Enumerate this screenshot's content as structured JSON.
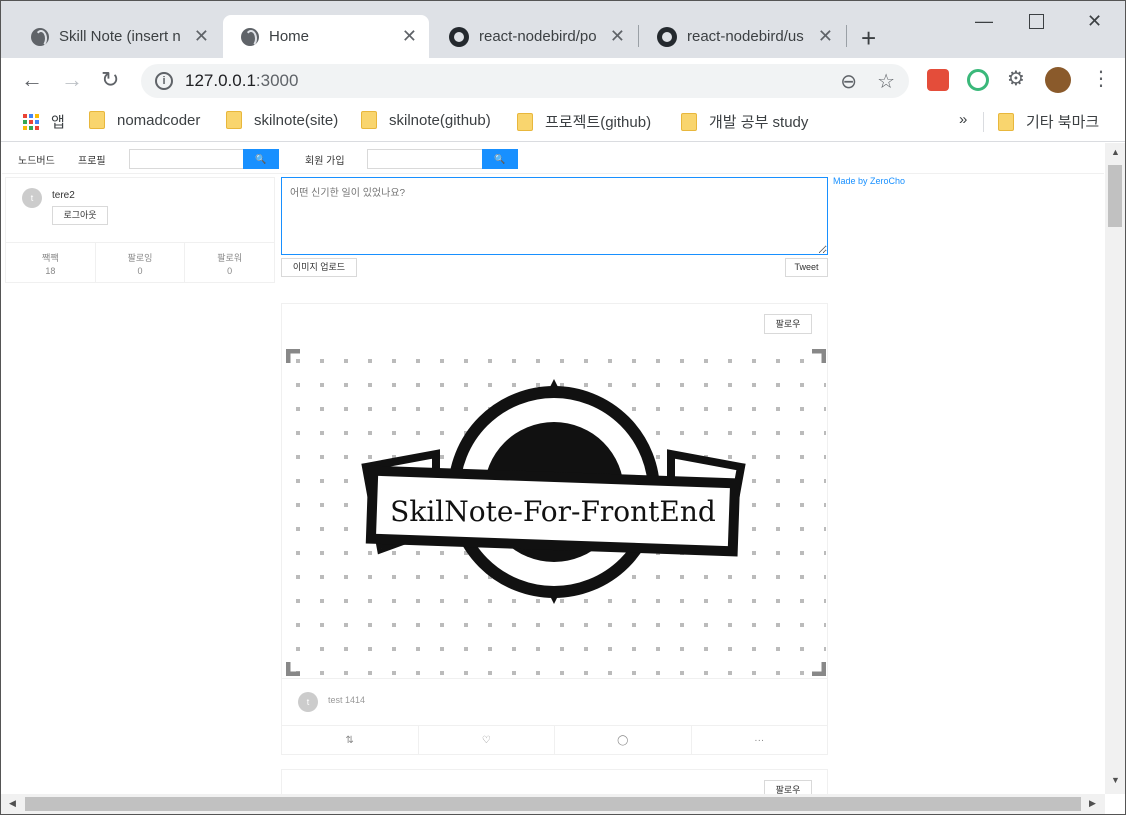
{
  "browser": {
    "tabs": [
      {
        "title": "Skill Note (insert n",
        "icon": "globe-icon",
        "active": false
      },
      {
        "title": "Home",
        "icon": "globe-icon",
        "active": true
      },
      {
        "title": "react-nodebird/po",
        "icon": "github-icon",
        "active": false
      },
      {
        "title": "react-nodebird/us",
        "icon": "github-icon",
        "active": false
      }
    ],
    "new_tab": "+",
    "close_glyph": "✕",
    "url_host": "127.0.0.1",
    "url_port": ":3000",
    "bookmarks": {
      "apps_label": "앱",
      "items": [
        "nomadcoder",
        "skilnote(site)",
        "skilnote(github)",
        "프로젝트(github)",
        "개발 공부 study"
      ],
      "overflow": "»",
      "other": "기타 북마크"
    }
  },
  "app": {
    "menu": {
      "nodebird": "노드버드",
      "profile": "프로필",
      "signup": "회원 가입",
      "search_icon": "🔍"
    },
    "user": {
      "avatar_letter": "t",
      "nickname": "tere2",
      "logout_label": "로그아웃",
      "stats": [
        {
          "label": "짹짹",
          "value": "18"
        },
        {
          "label": "팔로잉",
          "value": "0"
        },
        {
          "label": "팔로워",
          "value": "0"
        }
      ]
    },
    "post_form": {
      "placeholder": "어떤 신기한 일이 있었나요?",
      "upload_label": "이미지 업로드",
      "tweet_label": "Tweet"
    },
    "made_by": "Made by ZeroCho",
    "posts": [
      {
        "follow_label": "팔로우",
        "image_text": "SkilNote-For-FrontEnd",
        "author_letter": "t",
        "author": "test 1414",
        "actions": [
          "retweet-icon",
          "heart-icon",
          "comment-icon",
          "ellipsis-icon"
        ],
        "ellipsis": "···"
      },
      {
        "follow_label": "팔로우"
      }
    ]
  },
  "colors": {
    "primary": "#1890ff",
    "tabstrip": "#dee1e6"
  }
}
